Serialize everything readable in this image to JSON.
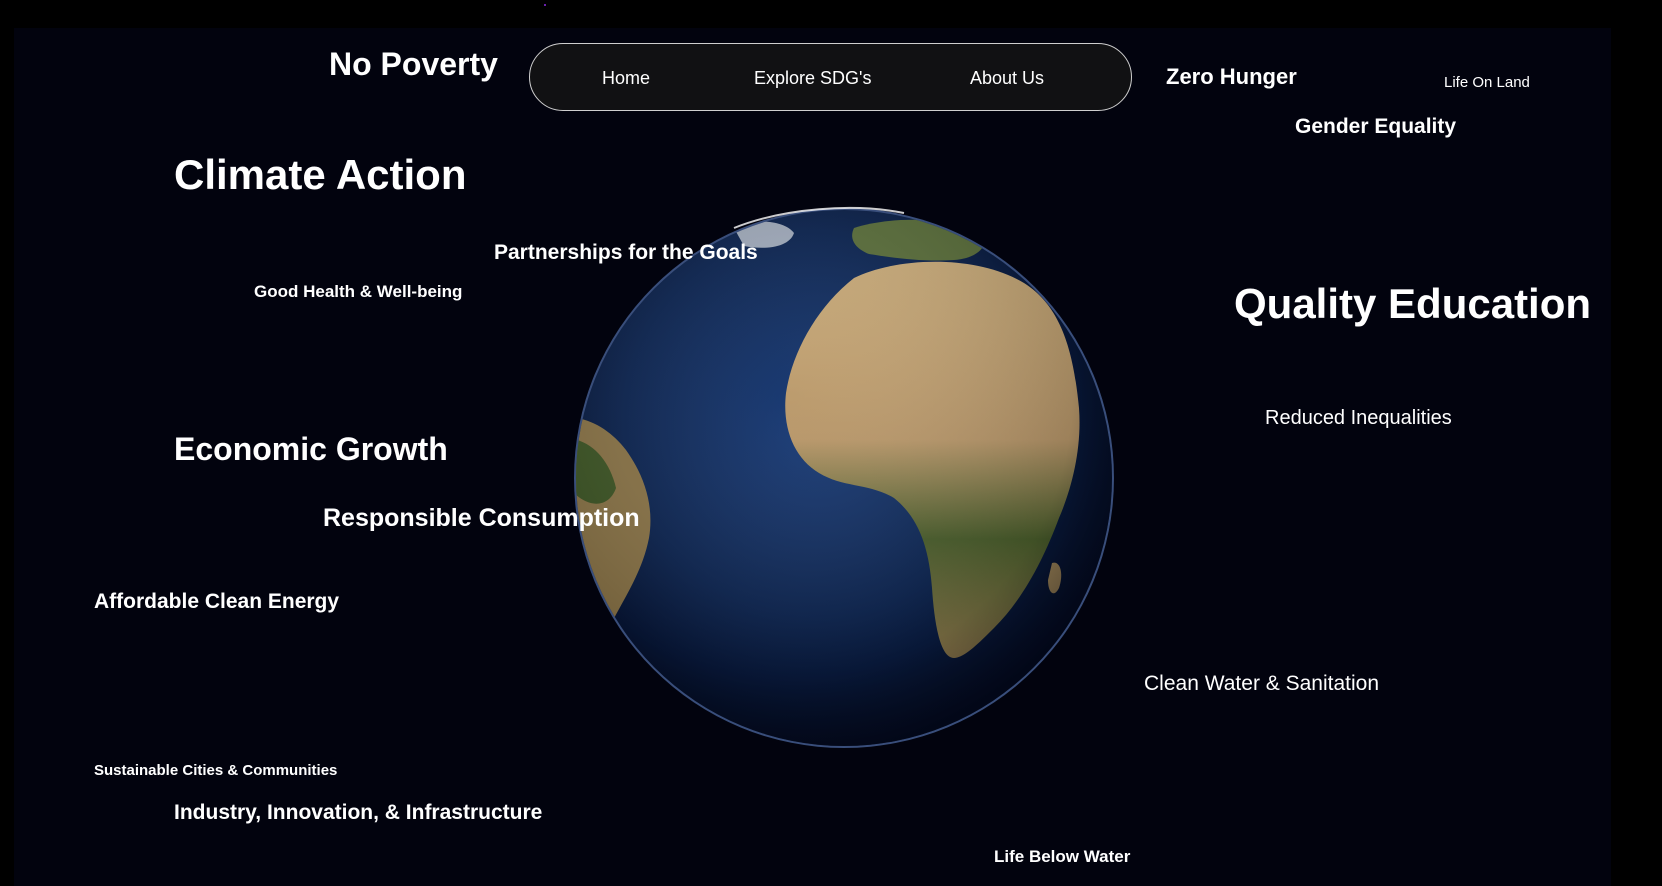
{
  "nav": {
    "links": [
      "Home",
      "Explore SDG's",
      "About Us"
    ]
  },
  "goals": {
    "no_poverty": "No Poverty",
    "zero_hunger": "Zero Hunger",
    "life_on_land": "Life On Land",
    "gender_equality": "Gender Equality",
    "climate_action": "Climate Action",
    "partnerships": "Partnerships for the Goals",
    "good_health": "Good Health & Well-being",
    "quality_education": "Quality Education",
    "reduced_inequalities": "Reduced Inequalities",
    "economic_growth": "Economic Growth",
    "responsible_consumption": "Responsible Consumption",
    "clean_energy": "Affordable Clean Energy",
    "clean_water": "Clean Water & Sanitation",
    "sustainable_cities": "Sustainable Cities & Communities",
    "industry": "Industry, Innovation, & Infrastructure",
    "life_below_water": "Life Below Water"
  },
  "colors": {
    "page_bg": "#000000",
    "stage_bg": "#02030e",
    "ocean": "#0b2a5c",
    "land": "#b49a6a",
    "vegetation": "#3f5a2a"
  },
  "icons": {
    "globe": "earth-globe-image"
  }
}
